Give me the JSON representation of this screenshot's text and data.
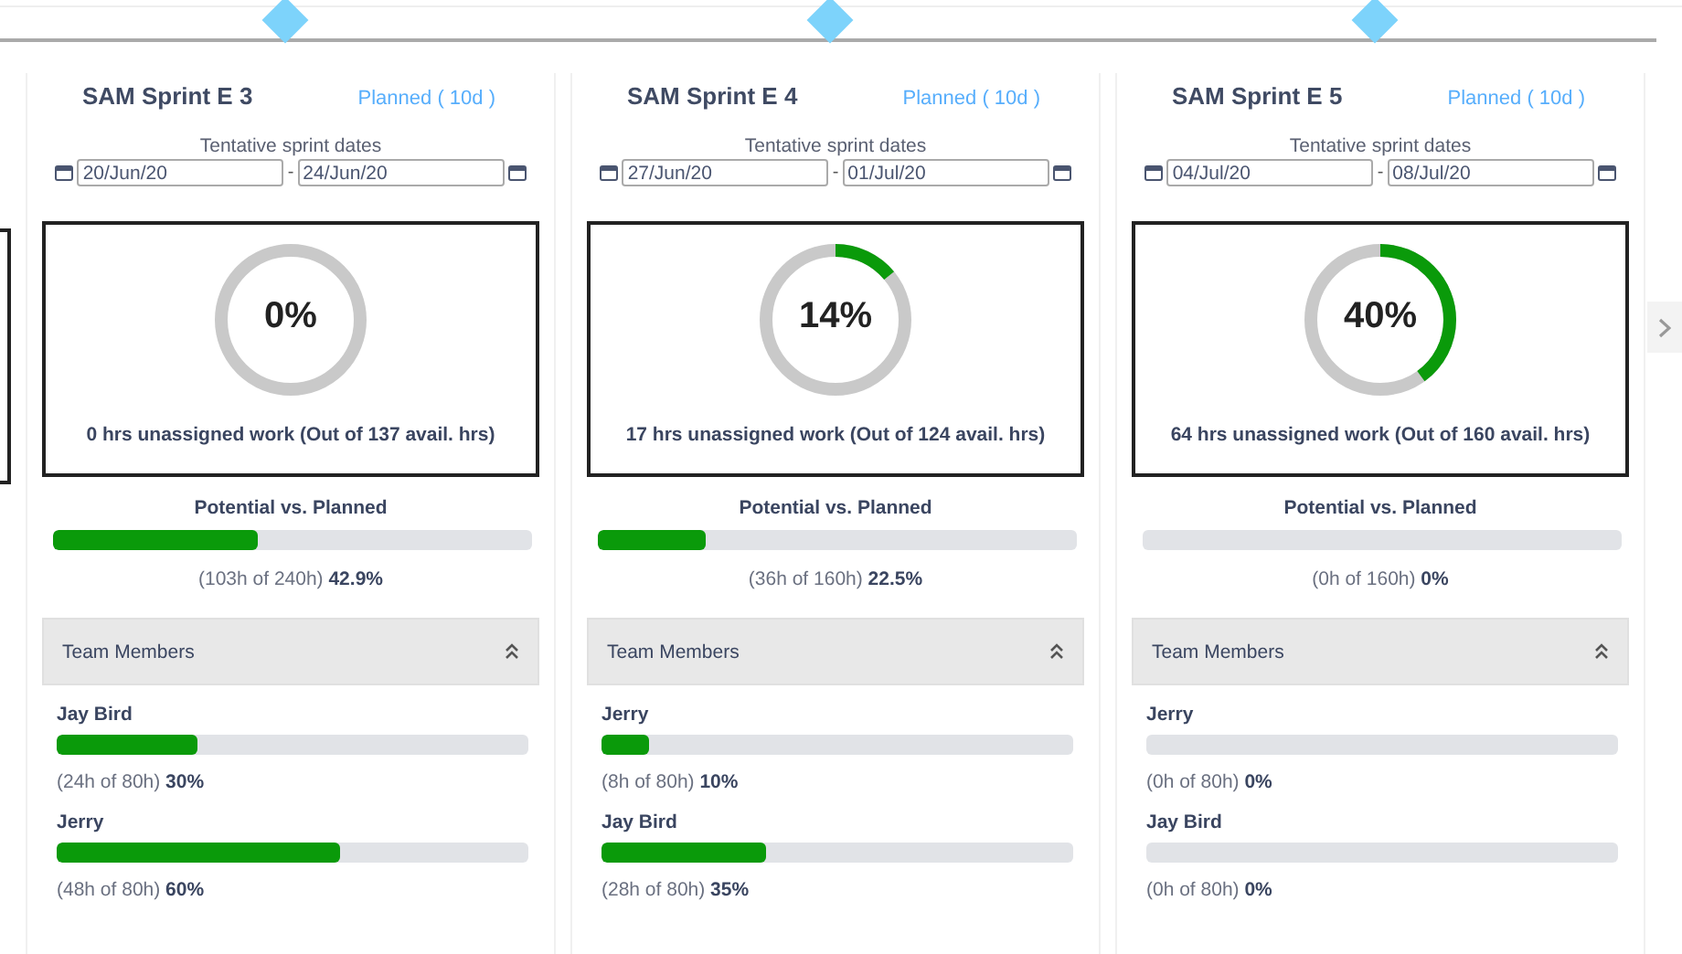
{
  "sprints": [
    {
      "title": "SAM Sprint E 3",
      "status": "Planned ( 10d )",
      "dates_label": "Tentative sprint dates",
      "start": "20/Jun/20",
      "end": "24/Jun/20",
      "separator": "-",
      "percent": "0%",
      "summary": "0 hrs unassigned work (Out of 137 avail. hrs)",
      "potential": {
        "label": "Potential vs. Planned",
        "level": 0.429,
        "reading": "(103h of 240h) **42.9%**"
      },
      "team": {
        "title": "Team Members",
        "expanded": true,
        "members": [
          {
            "name": "Jay Bird",
            "level": 0.3,
            "reading": "(24h of 80h) **30%**"
          },
          {
            "name": "Jerry",
            "level": 0.6,
            "reading": "(48h of 80h) **60%**"
          }
        ]
      }
    },
    {
      "title": "SAM Sprint E 4",
      "status": "Planned ( 10d )",
      "dates_label": "Tentative sprint dates",
      "start": "27/Jun/20",
      "end": "01/Jul/20",
      "separator": "-",
      "percent": "14%",
      "summary": "17 hrs unassigned work (Out of 124 avail. hrs)",
      "potential": {
        "label": "Potential vs. Planned",
        "level": 0.225,
        "reading": "(36h of 160h) **22.5%**"
      },
      "team": {
        "title": "Team Members",
        "expanded": true,
        "members": [
          {
            "name": "Jerry",
            "level": 0.1,
            "reading": "(8h of 80h) **10%**"
          },
          {
            "name": "Jay Bird",
            "level": 0.35,
            "reading": "(28h of 80h) **35%**"
          }
        ]
      }
    },
    {
      "title": "SAM Sprint E 5",
      "status": "Planned ( 10d )",
      "dates_label": "Tentative sprint dates",
      "start": "04/Jul/20",
      "end": "08/Jul/20",
      "separator": "-",
      "percent": "40%",
      "summary": "64 hrs unassigned work (Out of 160 avail. hrs)",
      "potential": {
        "label": "Potential vs. Planned",
        "level": 0,
        "reading": "(0h of 160h) **0%**"
      },
      "team": {
        "title": "Team Members",
        "expanded": true,
        "members": [
          {
            "name": "Jerry",
            "level": 0,
            "reading": "(0h of 80h) **0%**"
          },
          {
            "name": "Jay Bird",
            "level": 0,
            "reading": "(0h of 80h) **0%**"
          }
        ]
      }
    }
  ]
}
